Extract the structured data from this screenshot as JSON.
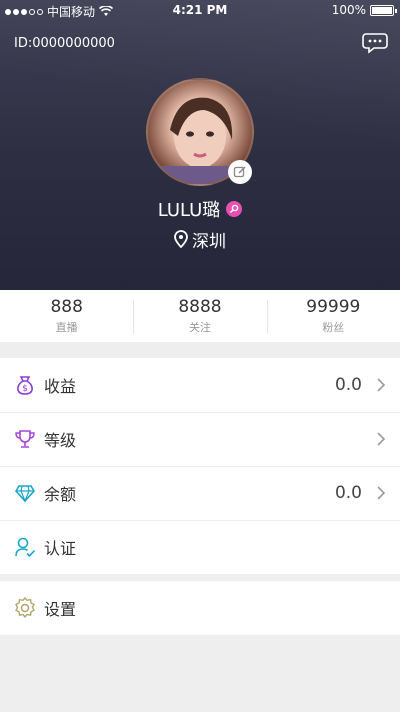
{
  "status_bar": {
    "carrier": "中国移动",
    "time": "4:21 PM",
    "battery": "100%"
  },
  "profile": {
    "id": "ID:0000000000",
    "username": "LULU璐",
    "location": "深圳"
  },
  "stats": [
    {
      "value": "888",
      "label": "直播"
    },
    {
      "value": "8888",
      "label": "关注"
    },
    {
      "value": "99999",
      "label": "粉丝"
    }
  ],
  "menu": [
    {
      "label": "收益",
      "value": "0.0",
      "icon": "money-bag-icon"
    },
    {
      "label": "等级",
      "value": "",
      "icon": "trophy-icon"
    },
    {
      "label": "余额",
      "value": "0.0",
      "icon": "diamond-icon"
    },
    {
      "label": "认证",
      "value": "",
      "icon": "user-verify-icon"
    }
  ],
  "settings": {
    "label": "设置",
    "icon": "gear-icon"
  },
  "colors": {
    "header_bg": "#2e2e42",
    "accent_purple": "#8a3fd6",
    "accent_cyan": "#1aa6c9",
    "gender_pink": "#e84fb3"
  }
}
